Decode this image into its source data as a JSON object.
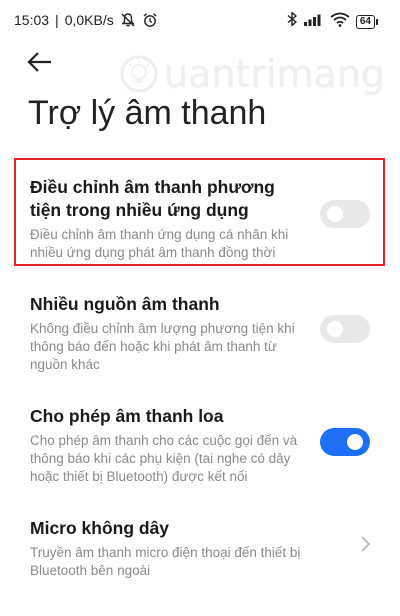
{
  "status_bar": {
    "time": "15:03",
    "network_speed": "0,0KB/s",
    "icons_left": [
      "mute-notifications-icon",
      "alarm-icon"
    ],
    "icons_right": [
      "bluetooth-icon",
      "signal-icon",
      "wifi-icon"
    ],
    "battery_level": "64"
  },
  "header": {
    "back_icon": "arrow-left-icon",
    "title": "Trợ lý âm thanh"
  },
  "watermark": {
    "text": "uantrimang"
  },
  "settings": [
    {
      "title": "Điều chỉnh âm thanh phương tiện trong nhiều ứng dụng",
      "description": "Điều chỉnh âm thanh ứng dụng cá nhân khi nhiều ứng dụng phát âm thanh đồng thời",
      "control": "toggle",
      "enabled": false,
      "highlighted": true
    },
    {
      "title": "Nhiều nguồn âm thanh",
      "description": "Không điều chỉnh âm lượng phương tiện khi thông báo đến hoặc khi phát âm thanh từ nguồn khác",
      "control": "toggle",
      "enabled": false,
      "highlighted": false
    },
    {
      "title": "Cho phép âm thanh loa",
      "description": "Cho phép âm thanh cho các cuộc gọi đến và thông báo khi các phụ kiện (tai nghe có dây hoặc thiết bị Bluetooth) được kết nối",
      "control": "toggle",
      "enabled": true,
      "highlighted": false
    },
    {
      "title": "Micro không dây",
      "description": "Truyền âm thanh micro điện thoại đến thiết bị Bluetooth bên ngoài",
      "control": "chevron-right-icon",
      "enabled": null,
      "highlighted": false
    }
  ],
  "colors": {
    "highlight_border": "#e2232a",
    "toggle_on": "#1e6ff5",
    "toggle_off": "#e8e8e8",
    "description_text": "#8a8a8a"
  }
}
